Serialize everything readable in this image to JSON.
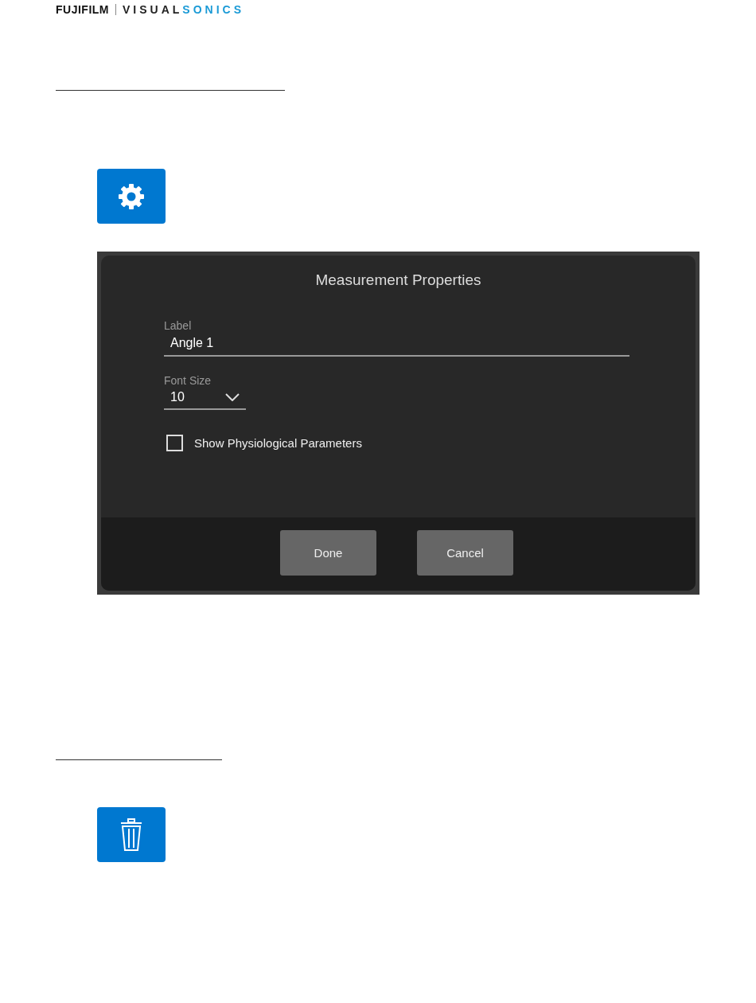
{
  "header": {
    "logo_left": "FUJIFILM",
    "logo_right_a": "VISUAL",
    "logo_right_b": "SONICS"
  },
  "dialog": {
    "title": "Measurement Properties",
    "label_field": {
      "label": "Label",
      "value": "Angle 1"
    },
    "font_size": {
      "label": "Font Size",
      "value": "10"
    },
    "checkbox": {
      "label": "Show Physiological Parameters",
      "checked": false
    },
    "buttons": [
      "Done",
      "Cancel"
    ]
  }
}
